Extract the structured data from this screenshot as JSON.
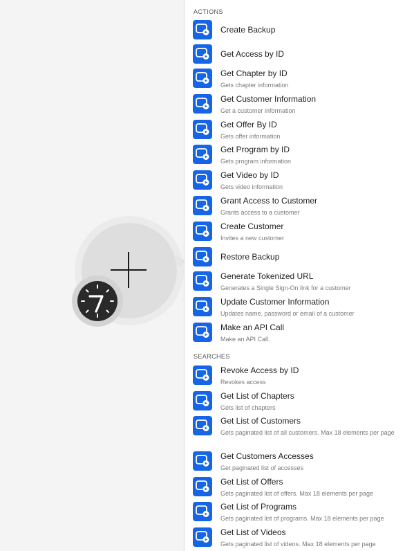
{
  "colors": {
    "accent": "#1565e6",
    "panel_bg": "#ffffff",
    "canvas_bg": "#f4f4f4"
  },
  "canvas": {
    "node_icon": "plus-icon",
    "app_icon": "clock-logo-icon"
  },
  "panel": {
    "actions": {
      "header": "ACTIONS",
      "items": [
        {
          "title": "Create Backup",
          "desc": ""
        },
        {
          "title": "Get Access by ID",
          "desc": ""
        },
        {
          "title": "Get Chapter by ID",
          "desc": "Gets chapter information"
        },
        {
          "title": "Get Customer Information",
          "desc": "Get a customer information"
        },
        {
          "title": "Get Offer By ID",
          "desc": "Gets offer information"
        },
        {
          "title": "Get Program by ID",
          "desc": "Gets program information"
        },
        {
          "title": "Get Video by ID",
          "desc": "Gets video information"
        },
        {
          "title": "Grant Access to Customer",
          "desc": "Grants access to a customer"
        },
        {
          "title": "Create Customer",
          "desc": "Invites a new customer"
        },
        {
          "title": "Restore Backup",
          "desc": ""
        },
        {
          "title": "Generate Tokenized URL",
          "desc": "Generates a Single Sign-On link for a customer"
        },
        {
          "title": "Update Customer Information",
          "desc": "Updates name, password or email of a customer"
        },
        {
          "title": "Make an API Call",
          "desc": "Make an API Call."
        }
      ]
    },
    "searches": {
      "header": "SEARCHES",
      "items": [
        {
          "title": "Revoke Access by ID",
          "desc": "Revokes access"
        },
        {
          "title": "Get List of Chapters",
          "desc": "Gets list of chapters"
        },
        {
          "title": "Get List of Customers",
          "desc": "Gets paginated list of all customers. Max 18 elements per page"
        },
        {
          "title": "Get Customers Accesses",
          "desc": "Get paginated list of accesses"
        },
        {
          "title": "Get List of Offers",
          "desc": "Gets paginated list of offers. Max 18 elements per page"
        },
        {
          "title": "Get List of Programs",
          "desc": "Gets paginated list of programs. Max 18 elements per page"
        },
        {
          "title": "Get List of Videos",
          "desc": "Gets paginated list of videos. Max 18 elements per page"
        }
      ]
    }
  }
}
